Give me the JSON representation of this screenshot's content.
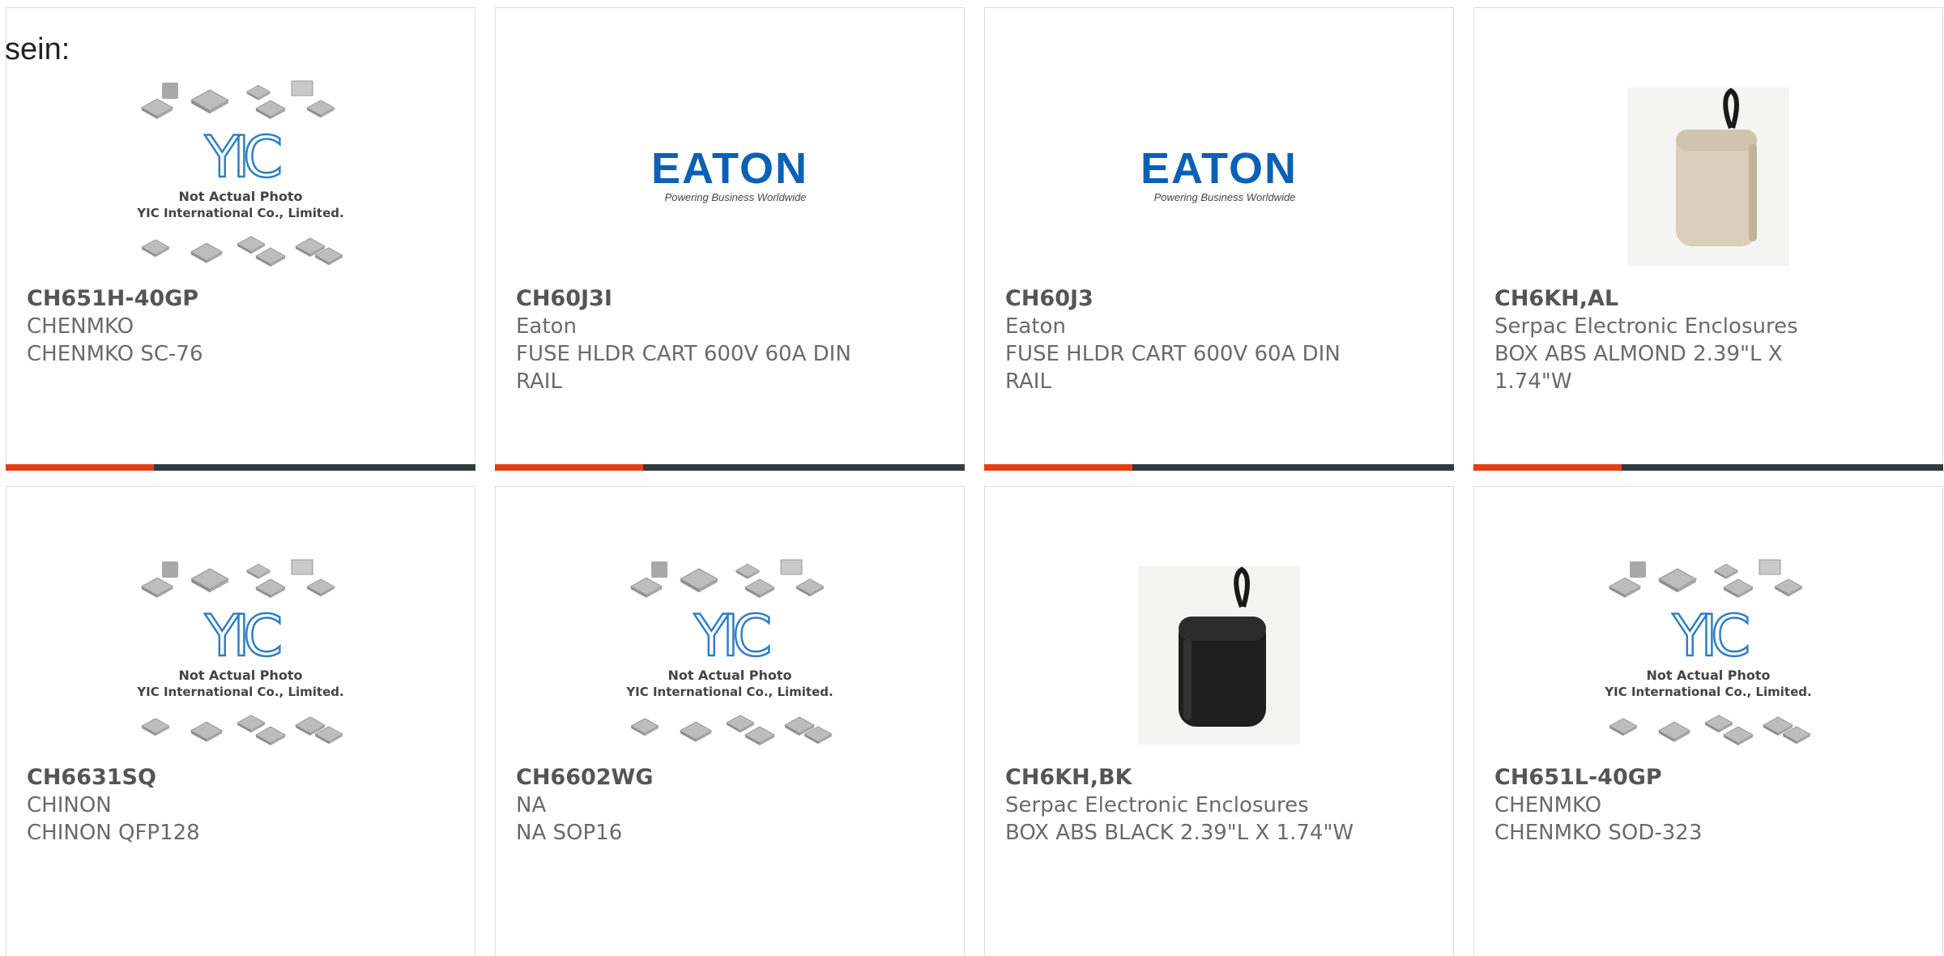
{
  "lead_text": "sein:",
  "colors": {
    "accent": "#e53e14",
    "bar": "#333a3c",
    "eaton_blue": "#0a61b5"
  },
  "placeholder_image": {
    "line1": "Not Actual Photo",
    "line2": "YIC International Co., Limited.",
    "logo": "YIC"
  },
  "eaton_image": {
    "logo": "EATON",
    "tagline": "Powering Business Worldwide"
  },
  "products": [
    {
      "part": "CH651H-40GP",
      "maker": "CHENMKO",
      "desc": "CHENMKO SC-76",
      "image": "yic-placeholder"
    },
    {
      "part": "CH60J3I",
      "maker": "Eaton",
      "desc": "FUSE HLDR CART 600V 60A DIN RAIL",
      "image": "eaton-logo"
    },
    {
      "part": "CH60J3",
      "maker": "Eaton",
      "desc": "FUSE HLDR CART 600V 60A DIN RAIL",
      "image": "eaton-logo"
    },
    {
      "part": "CH6KH,AL",
      "maker": "Serpac Electronic Enclosures",
      "desc": "BOX ABS ALMOND 2.39\"L X 1.74\"W",
      "image": "almond-enclosure"
    },
    {
      "part": "CH6631SQ",
      "maker": "CHINON",
      "desc": "CHINON QFP128",
      "image": "yic-placeholder"
    },
    {
      "part": "CH6602WG",
      "maker": "NA",
      "desc": "NA SOP16",
      "image": "yic-placeholder"
    },
    {
      "part": "CH6KH,BK",
      "maker": "Serpac Electronic Enclosures",
      "desc": "BOX ABS BLACK 2.39\"L X 1.74\"W",
      "image": "black-enclosure"
    },
    {
      "part": "CH651L-40GP",
      "maker": "CHENMKO",
      "desc": "CHENMKO SOD-323",
      "image": "yic-placeholder"
    }
  ]
}
